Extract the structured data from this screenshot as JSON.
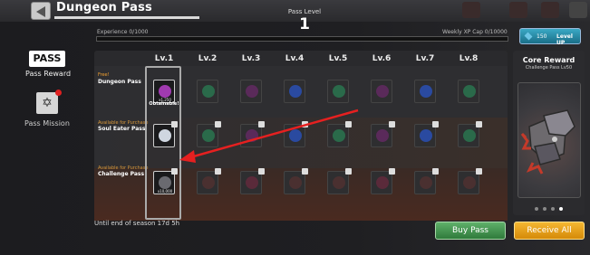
{
  "header": {
    "title": "Dungeon Pass",
    "pass_level_label": "Pass Level",
    "pass_level_value": "1",
    "experience_label": "Experience 0/1000",
    "xp_cap_label": "Weekly XP Cap 0/10000",
    "xp_progress": 0,
    "level_up": {
      "cost": "150",
      "label": "Level UP"
    }
  },
  "sidebar": {
    "pass_icon": "PASS",
    "pass_reward_label": "Pass Reward",
    "pass_mission_label": "Pass Mission"
  },
  "grid": {
    "levels": [
      "Lv.1",
      "Lv.2",
      "Lv.3",
      "Lv.4",
      "Lv.5",
      "Lv.6",
      "Lv.7",
      "Lv.8"
    ],
    "rows": [
      {
        "tag": "Free!",
        "name": "Dungeon Pass",
        "color": "#3a3a3d"
      },
      {
        "tag": "Available for Purchase",
        "name": "Soul Eater Pass",
        "color": "#4a3a30"
      },
      {
        "tag": "Available for Purchase",
        "name": "Challenge Pass",
        "color": "#5a3328"
      }
    ],
    "first_cell_status": "Obtainable!",
    "quantities": [
      "x1,250",
      "",
      "x10,000"
    ]
  },
  "footer": {
    "season_label": "Until end of season 17d 5h",
    "buy_label": "Buy Pass",
    "receive_label": "Receive All"
  },
  "core_reward": {
    "title": "Core Reward",
    "subtitle": "Challenge Pass Lv50",
    "icon": "dark-gauntlet-icon",
    "page_count": 4,
    "active_page": 4
  },
  "colors": {
    "accent_orange": "#d58a08",
    "accent_green": "#2f7a3b",
    "annotation_red": "#e62020"
  }
}
